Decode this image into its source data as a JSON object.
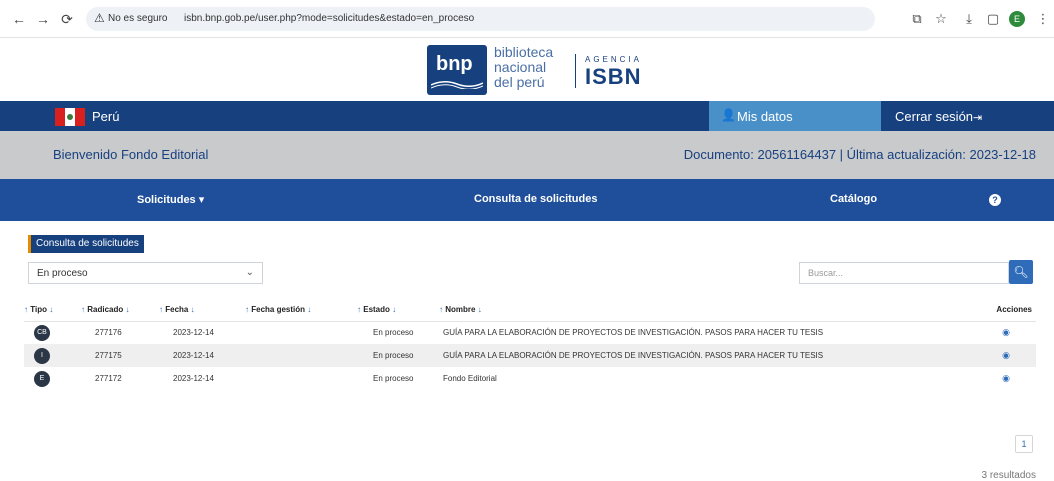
{
  "browser": {
    "security_label": "No es seguro",
    "url": "isbn.bnp.gob.pe/user.php?mode=solicitudes&estado=en_proceso",
    "profile_initial": "E"
  },
  "brand": {
    "logo_short": "bnp",
    "logo_line1": "biblioteca",
    "logo_line2": "nacional",
    "logo_line3": "del perú",
    "agency_label": "AGENCIA",
    "agency_name": "ISBN"
  },
  "topnav": {
    "country": "Perú",
    "my_data": "Mis datos",
    "logout": "Cerrar sesión"
  },
  "welcome": {
    "greeting": "Bienvenido Fondo Editorial",
    "document_info": "Documento: 20561164437 | Última actualización: 2023-12-18"
  },
  "menu": {
    "requests": "Solicitudes",
    "query": "Consulta de solicitudes",
    "catalog": "Catálogo"
  },
  "content": {
    "section_title": "Consulta de solicitudes",
    "filter_value": "En proceso",
    "search_placeholder": "Buscar...",
    "columns": [
      "Tipo",
      "Radicado",
      "Fecha",
      "Fecha gestión",
      "Estado",
      "Nombre",
      "Acciones"
    ],
    "rows": [
      {
        "tipo": "CB",
        "radicado": "277176",
        "fecha": "2023-12-14",
        "fecha_gestion": "",
        "estado": "En proceso",
        "nombre": "GUÍA PARA LA ELABORACIÓN DE PROYECTOS DE INVESTIGACIÓN. PASOS PARA HACER TU TESIS"
      },
      {
        "tipo": "I",
        "radicado": "277175",
        "fecha": "2023-12-14",
        "fecha_gestion": "",
        "estado": "En proceso",
        "nombre": "GUÍA PARA LA ELABORACIÓN DE PROYECTOS DE INVESTIGACIÓN. PASOS PARA HACER TU TESIS"
      },
      {
        "tipo": "E",
        "radicado": "277172",
        "fecha": "2023-12-14",
        "fecha_gestion": "",
        "estado": "En proceso",
        "nombre": "Fondo Editorial"
      }
    ],
    "page": "1",
    "results": "3 resultados"
  },
  "colors": {
    "nav_dark": "#17407f",
    "menu_blue": "#1f4f9a",
    "accent_light": "#4a90c8",
    "welcome_gray": "#c9cacc"
  },
  "icons": [
    "back-icon",
    "forward-icon",
    "reload-icon",
    "warning-icon",
    "translate-icon",
    "star-icon",
    "download-icon",
    "sidepanel-icon",
    "menu-icon",
    "user-icon",
    "logout-icon",
    "help-icon",
    "search-icon",
    "eye-icon",
    "sort-arrow-icon"
  ]
}
